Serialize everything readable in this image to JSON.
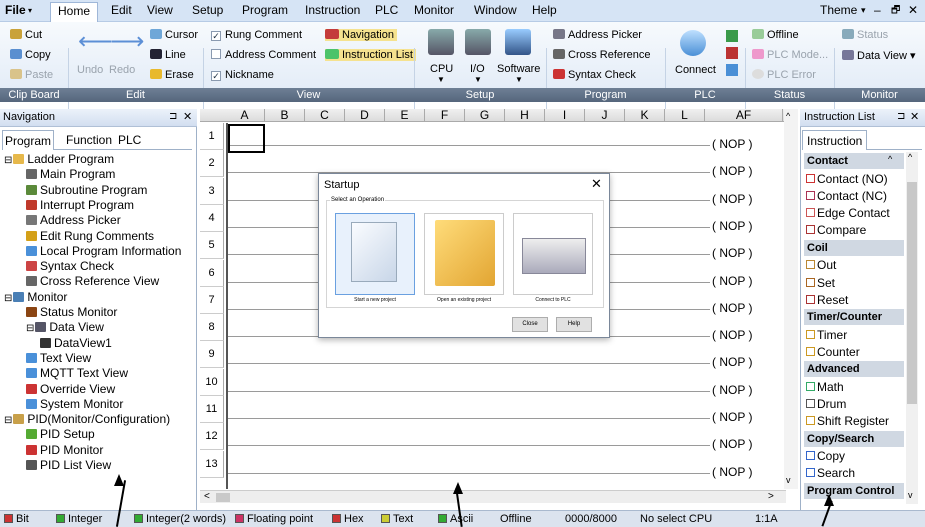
{
  "menu": {
    "file": "File",
    "items": [
      "Home",
      "Edit",
      "View",
      "Setup",
      "Program",
      "Instruction",
      "PLC",
      "Monitor",
      "Window",
      "Help"
    ],
    "theme": "Theme",
    "window_controls": [
      "▾",
      "‒",
      "🗗",
      "✕"
    ]
  },
  "ribbon": {
    "clipboard": {
      "cut": "Cut",
      "copy": "Copy",
      "paste": "Paste"
    },
    "edit": {
      "undo": "Undo",
      "redo": "Redo",
      "cursor": "Cursor",
      "line": "Line",
      "erase": "Erase"
    },
    "view": {
      "rung_comment": "Rung Comment",
      "address_comment": "Address Comment",
      "nickname": "Nickname",
      "navigation": "Navigation",
      "instruction_list": "Instruction List"
    },
    "setup": {
      "cpu": "CPU",
      "io": "I/O",
      "software": "Software"
    },
    "program": {
      "address_picker": "Address Picker",
      "cross_reference": "Cross Reference",
      "syntax_check": "Syntax Check"
    },
    "plc": {
      "connect": "Connect"
    },
    "status": {
      "offline": "Offline",
      "plc_mode": "PLC Mode...",
      "plc_error": "PLC Error"
    },
    "monitor": {
      "status": "Status",
      "data_view": "Data View"
    },
    "groups": [
      "Clip Board",
      "Edit",
      "View",
      "Setup",
      "Program",
      "PLC",
      "Status",
      "Monitor"
    ]
  },
  "navigation": {
    "title": "Navigation",
    "pin": "⊐",
    "close": "✕",
    "tabs": [
      "Program",
      "Function",
      "PLC"
    ],
    "tree": [
      {
        "label": "Ladder Program",
        "level": 0,
        "toggle": "⊟"
      },
      {
        "label": "Main Program",
        "level": 1
      },
      {
        "label": "Subroutine Program",
        "level": 1
      },
      {
        "label": "Interrupt Program",
        "level": 1
      },
      {
        "label": "Address Picker",
        "level": 1
      },
      {
        "label": "Edit Rung Comments",
        "level": 1
      },
      {
        "label": "Local Program Information",
        "level": 1
      },
      {
        "label": "Syntax Check",
        "level": 1
      },
      {
        "label": "Cross Reference View",
        "level": 1
      },
      {
        "label": "Monitor",
        "level": 0,
        "toggle": "⊟"
      },
      {
        "label": "Status Monitor",
        "level": 1
      },
      {
        "label": "Data View",
        "level": 1,
        "toggle": "⊟"
      },
      {
        "label": "DataView1",
        "level": 2
      },
      {
        "label": "Text View",
        "level": 1
      },
      {
        "label": "MQTT Text View",
        "level": 1
      },
      {
        "label": "Override View",
        "level": 1
      },
      {
        "label": "System Monitor",
        "level": 1
      },
      {
        "label": "PID(Monitor/Configuration)",
        "level": 0,
        "toggle": "⊟"
      },
      {
        "label": "PID Setup",
        "level": 1
      },
      {
        "label": "PID Monitor",
        "level": 1
      },
      {
        "label": "PID List View",
        "level": 1
      }
    ]
  },
  "ladder": {
    "columns": [
      "A",
      "B",
      "C",
      "D",
      "E",
      "F",
      "G",
      "H",
      "I",
      "J",
      "K",
      "L",
      "AF"
    ],
    "rows": [
      "1",
      "2",
      "3",
      "4",
      "5",
      "6",
      "7",
      "8",
      "9",
      "10",
      "11",
      "12",
      "13"
    ],
    "nop": "( NOP )",
    "scroll_left": "<",
    "scroll_right": ">"
  },
  "dialog": {
    "title": "Startup",
    "close": "✕",
    "group_label": "Select an Operation",
    "options": [
      "Start a new project",
      "Open an existing project",
      "Connect to PLC"
    ],
    "buttons": [
      "Close",
      "Help"
    ]
  },
  "instruction_list": {
    "title": "Instruction List",
    "tab": "Instruction",
    "categories": [
      {
        "name": "Contact",
        "items": [
          "Contact (NO)",
          "Contact (NC)",
          "Edge Contact",
          "Compare"
        ]
      },
      {
        "name": "Coil",
        "items": [
          "Out",
          "Set",
          "Reset"
        ]
      },
      {
        "name": "Timer/Counter",
        "items": [
          "Timer",
          "Counter"
        ]
      },
      {
        "name": "Advanced",
        "items": [
          "Math",
          "Drum",
          "Shift Register"
        ]
      },
      {
        "name": "Copy/Search",
        "items": [
          "Copy",
          "Search"
        ]
      },
      {
        "name": "Program Control",
        "items": []
      }
    ]
  },
  "statusbar": {
    "bit": "Bit",
    "integer": "Integer",
    "integer2": "Integer(2 words)",
    "float": "Floating point",
    "hex": "Hex",
    "text": "Text",
    "ascii": "Ascii",
    "offline": "Offline",
    "memory": "0000/8000",
    "cpu": "No select CPU",
    "zoom": "1:1A"
  },
  "colors": {
    "accent": "#d6e4f5",
    "group_bar": "#5d6e84",
    "nav_border": "#9fb1c8"
  }
}
